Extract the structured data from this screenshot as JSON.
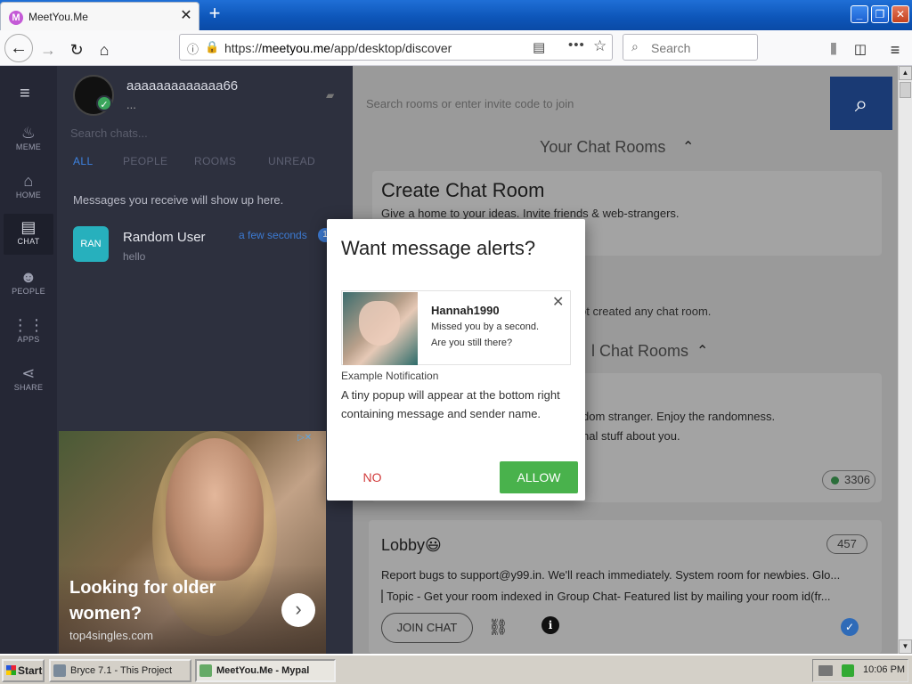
{
  "browser": {
    "tab_title": "MeetYou.Me",
    "tab_favicon": "M",
    "tab_close": "✕",
    "new_tab": "+",
    "url_prefix": "https://",
    "url_host": "meetyou.me",
    "url_path": "/app/desktop/discover",
    "search_placeholder": "Search",
    "window_buttons": [
      "_",
      "❐",
      "✕"
    ]
  },
  "rail": [
    {
      "label": "MEME",
      "icon": "flame-icon",
      "glyph": "♨"
    },
    {
      "label": "HOME",
      "icon": "home-icon",
      "glyph": "⌂"
    },
    {
      "label": "CHAT",
      "icon": "chat-icon",
      "glyph": "▤"
    },
    {
      "label": "PEOPLE",
      "icon": "people-icon",
      "glyph": "☻"
    },
    {
      "label": "APPS",
      "icon": "apps-grid-icon",
      "glyph": "⋮⋮"
    },
    {
      "label": "SHARE",
      "icon": "share-icon",
      "glyph": "⋖"
    }
  ],
  "chat_panel": {
    "username": "aaaaaaaaaaaaa66",
    "status": "...",
    "search_placeholder": "Search chats...",
    "filters": [
      "ALL",
      "PEOPLE",
      "ROOMS",
      "UNREAD"
    ],
    "empty_message": "Messages you receive will show up here.",
    "chats": [
      {
        "badge": "RAN",
        "name": "Random User",
        "preview": "hello",
        "time": "a few seconds",
        "unread": "1"
      }
    ]
  },
  "ad": {
    "headline": "Looking for older women?",
    "domain": "top4singles.com",
    "adchoices": "▷✕",
    "arrow": "›"
  },
  "main": {
    "room_search_placeholder": "Search rooms or enter invite code to join",
    "your_rooms_title": "Your Chat Rooms",
    "create_title": "Create Chat Room",
    "create_desc": "Give a home to your ideas. Invite friends & web-strangers.",
    "no_rooms_text": "ot created any chat room.",
    "featured_title": "l Chat Rooms",
    "random_desc1": "dom stranger. Enjoy the randomness.",
    "random_desc2": "nal stuff about you.",
    "random_count": "3306",
    "lobby": {
      "name": "Lobby😃",
      "count": "457",
      "desc": "Report bugs to support@y99.in. We'll reach immediately. System room for newbies. Glo...",
      "topic": "Topic - Get your room indexed in Group Chat- Featured list by mailing your room id(fr...",
      "join_label": "JOIN CHAT"
    }
  },
  "dialog": {
    "title": "Want message alerts?",
    "notif_name": "Hannah1990",
    "notif_line1": "Missed you by a second.",
    "notif_line2": "Are you still there?",
    "notif_close": "✕",
    "example_label": "Example Notification",
    "example_desc": "A tiny popup will appear at the bottom right containing message and sender name.",
    "no_label": "NO",
    "allow_label": "ALLOW"
  },
  "taskbar": {
    "start_label": "Start",
    "tasks": [
      "Bryce 7.1 - This Project",
      "MeetYou.Me - Mypal"
    ],
    "clock": "10:06 PM"
  }
}
